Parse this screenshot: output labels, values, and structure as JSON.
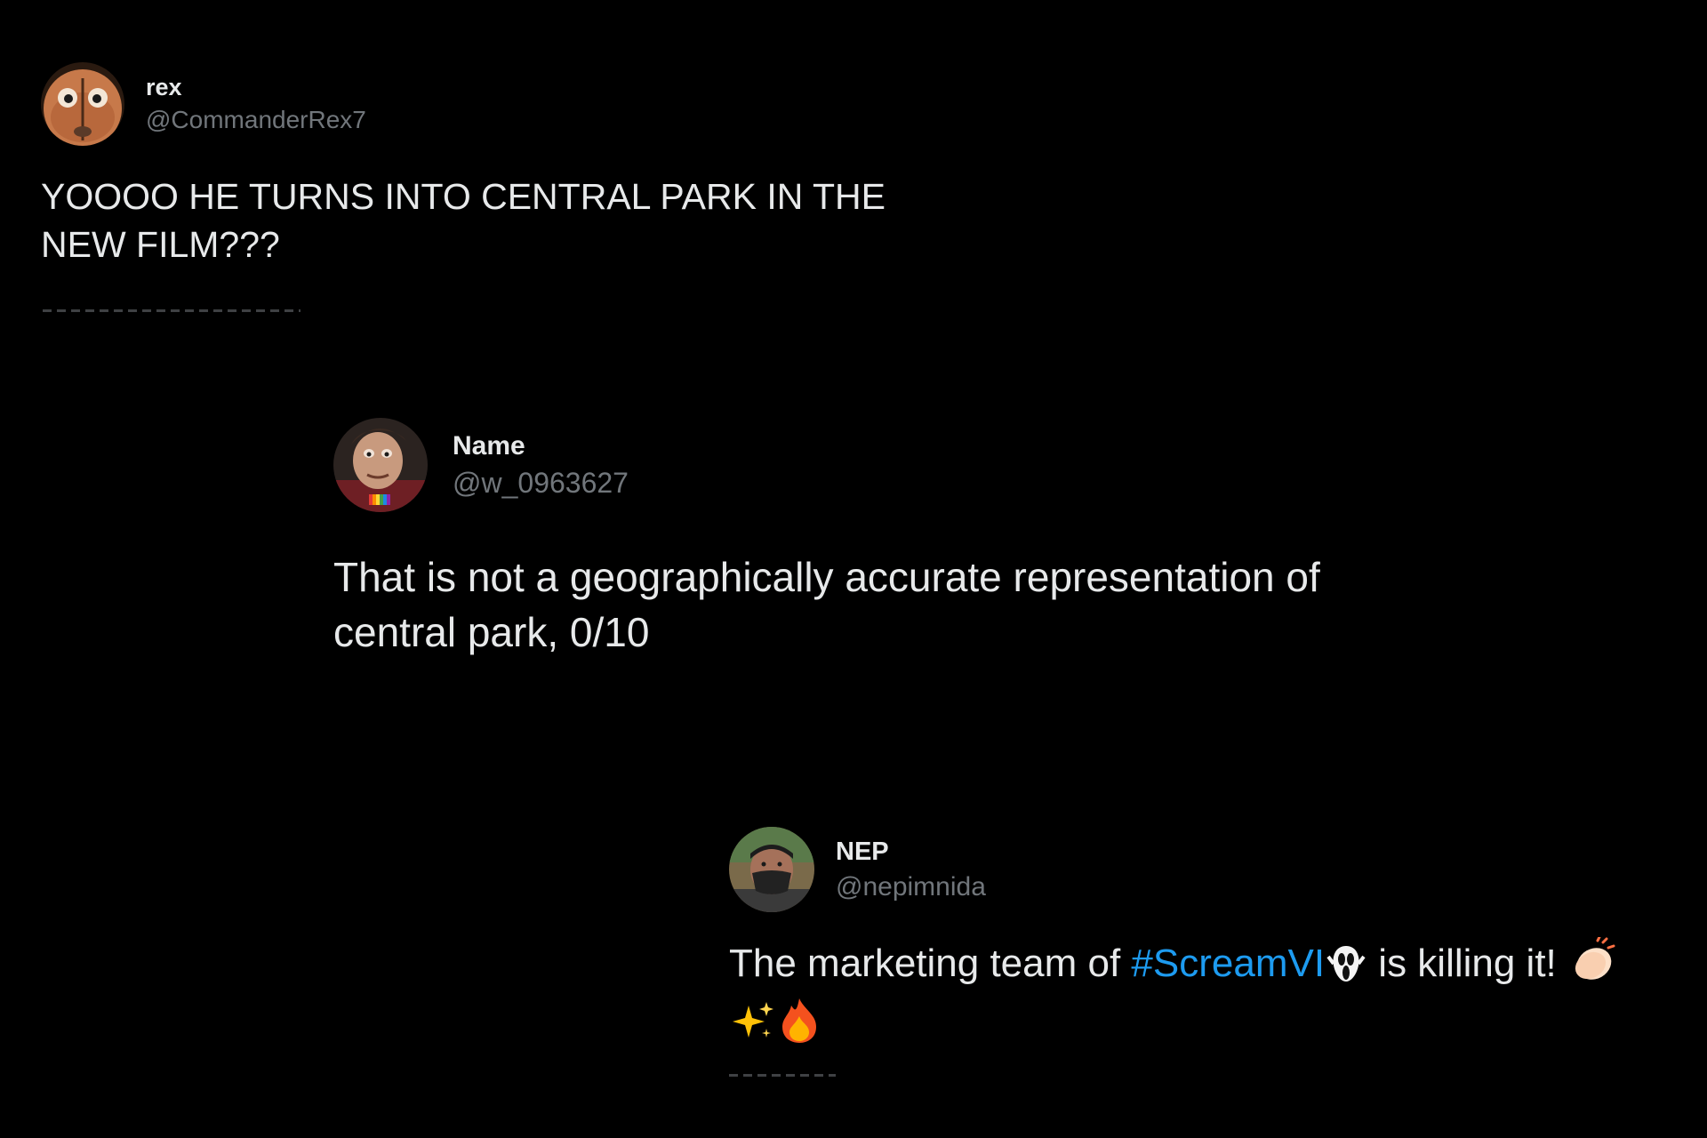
{
  "tweets": [
    {
      "display_name": "rex",
      "handle": "@CommanderRex7",
      "text": "YOOOO HE TURNS INTO CENTRAL PARK IN THE NEW FILM???",
      "avatar_icon": "cartoon-face-avatar"
    },
    {
      "display_name": "Name",
      "handle": "@w_0963627",
      "text": "That is not a geographically accurate representation of central park, 0/10",
      "avatar_icon": "cartoon-character-avatar"
    },
    {
      "display_name": "NEP",
      "handle": "@nepimnida",
      "text_before": "The marketing team of ",
      "hashtag": "#ScreamVI",
      "text_after": " is killing it!",
      "emojis": [
        "ghostface-mask-emoji",
        "clapping-hands-emoji",
        "sparkles-emoji",
        "fire-emoji"
      ],
      "avatar_icon": "person-with-mask-avatar"
    }
  ],
  "colors": {
    "background": "#000000",
    "text": "#e7e9ea",
    "handle": "#71767b",
    "hashtag": "#1d9bf0"
  }
}
